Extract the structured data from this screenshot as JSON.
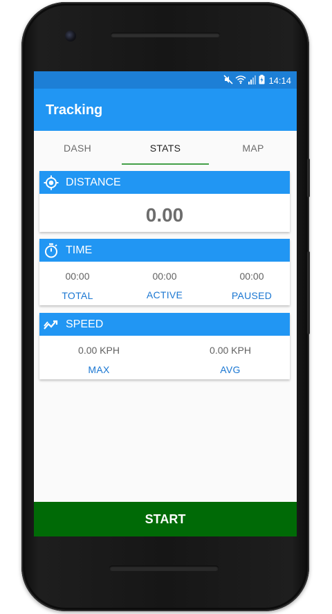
{
  "status_bar": {
    "time": "14:14",
    "icons": [
      "mute-icon",
      "wifi-icon",
      "signal-icon",
      "battery-icon"
    ]
  },
  "app_bar": {
    "title": "Tracking"
  },
  "tabs": [
    {
      "label": "DASH",
      "active": false
    },
    {
      "label": "STATS",
      "active": true
    },
    {
      "label": "MAP",
      "active": false
    }
  ],
  "distance": {
    "title": "DISTANCE",
    "icon": "gps-target-icon",
    "value": "0.00"
  },
  "time": {
    "title": "TIME",
    "icon": "stopwatch-icon",
    "items": [
      {
        "value": "00:00",
        "label": "TOTAL"
      },
      {
        "value": "00:00",
        "label": "ACTIVE"
      },
      {
        "value": "00:00",
        "label": "PAUSED"
      }
    ]
  },
  "speed": {
    "title": "SPEED",
    "icon": "trending-icon",
    "items": [
      {
        "value": "0.00 KPH",
        "label": "MAX"
      },
      {
        "value": "0.00 KPH",
        "label": "AVG"
      }
    ]
  },
  "start_button": {
    "label": "START"
  },
  "colors": {
    "primary": "#2196f3",
    "primary_dark": "#1d7fd6",
    "accent_tab": "#43a047",
    "label_blue": "#1976d2",
    "start_green": "#006a06"
  }
}
